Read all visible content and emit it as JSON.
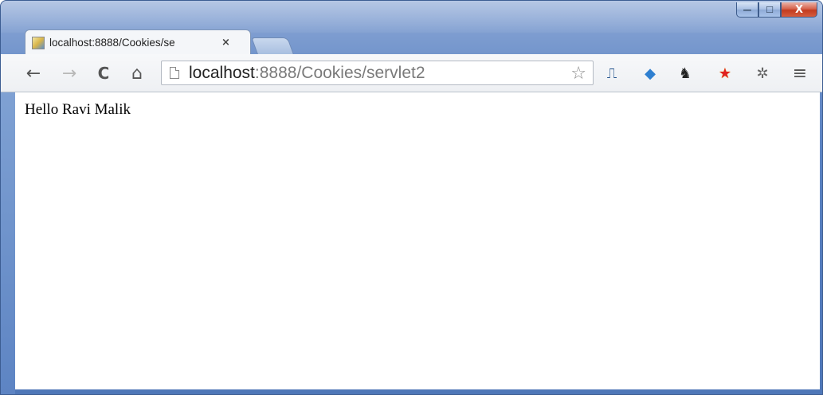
{
  "window": {
    "minimize_glyph": "—",
    "maximize_glyph": "☐",
    "close_glyph": "X"
  },
  "tab": {
    "title": "localhost:8888/Cookies/se",
    "close_glyph": "×"
  },
  "toolbar": {
    "back_glyph": "←",
    "forward_glyph": "→",
    "reload_glyph": "C",
    "home_glyph": "⌂",
    "url_host": "localhost",
    "url_rest": ":8888/Cookies/servlet2",
    "bookmark_glyph": "☆",
    "extensions": [
      {
        "icon": "translate-extension-icon",
        "glyph": "⎍"
      },
      {
        "icon": "rocket-extension-icon",
        "glyph": "◆"
      },
      {
        "icon": "ghostery-extension-icon",
        "glyph": "♞"
      },
      {
        "icon": "star-extension-icon",
        "glyph": "★"
      },
      {
        "icon": "puzzle-extension-icon",
        "glyph": "✲"
      }
    ],
    "menu_glyph": "≡"
  },
  "page": {
    "greeting": "Hello Ravi Malik"
  },
  "colors": {
    "frame": "#5a82c2",
    "close_button": "#c23b1f",
    "url_host": "#222222",
    "url_rest": "#7a7a7a"
  }
}
